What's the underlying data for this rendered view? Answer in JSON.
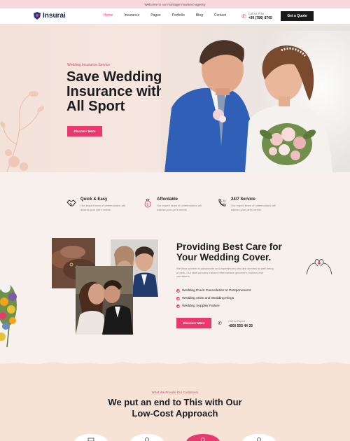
{
  "topbar": {
    "text": "Welcome to our marriage insurance agency"
  },
  "brand": {
    "name": "Insurai",
    "accent": "#e9386d",
    "navy": "#1e3a8a"
  },
  "nav": {
    "items": [
      {
        "label": "Home",
        "active": true
      },
      {
        "label": "Insurance"
      },
      {
        "label": "Pages"
      },
      {
        "label": "Portfolio"
      },
      {
        "label": "Blog"
      },
      {
        "label": "Contact"
      }
    ],
    "call_label": "Call us Free",
    "call_number": "+99 (786) 8765",
    "quote_button": "Get a Quote"
  },
  "hero": {
    "eyebrow": "Wedding Insurance Service",
    "title": "Save Wedding Insurance with All Sport",
    "button": "Discover More"
  },
  "features": [
    {
      "icon": "handshake-icon",
      "title": "Quick & Easy",
      "text": "Our expert team of veterinarians will assess your pet's needs"
    },
    {
      "icon": "money-bag-icon",
      "title": "Affordable",
      "text": "Our expert team of veterinarians will assess your pet's needs"
    },
    {
      "icon": "phone-24-icon",
      "title": "24/7 Service",
      "text": "Our expert team of veterinarians will assess your pet's needs"
    }
  ],
  "care": {
    "title": "Providing Best Care for Your Wedding Cover.",
    "text": "We have a team of passionate and experienced who are devoted to well being of pets. Our staff includes trained veterinarians groomers, trainers and caretakers.",
    "bullets": [
      "Wedding Event Cancellation or Postponement",
      "Wedding Attire and Wedding Rings",
      "Wedding Supplier Failure"
    ],
    "button": "Discover More",
    "expert_label": "Call to Expert",
    "expert_number": "+800 555 44 33"
  },
  "provide": {
    "eyebrow": "What We Provide Our Customers",
    "title": "We put an end to This with Our Low-Cost Approach"
  }
}
